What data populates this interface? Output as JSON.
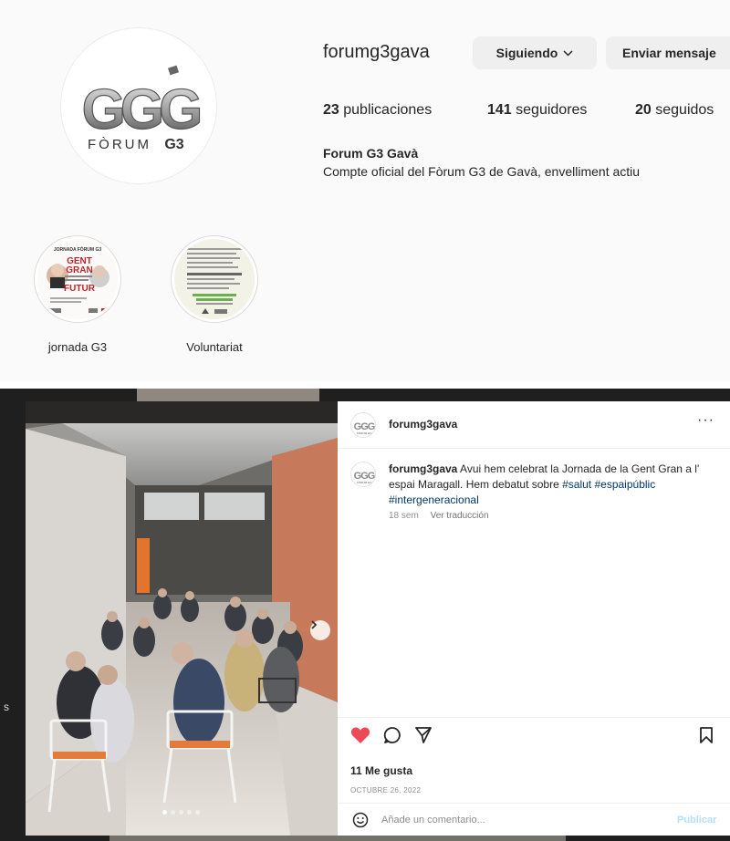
{
  "profile": {
    "username": "forumg3gava",
    "follow_button": "Siguiendo",
    "message_button": "Enviar mensaje",
    "stats": {
      "posts_count": "23",
      "posts_label": "publicaciones",
      "followers_count": "141",
      "followers_label": "seguidores",
      "following_count": "20",
      "following_label": "seguidos"
    },
    "display_name": "Forum G3 Gavà",
    "bio": "Compte oficial del Fòrum G3 de Gavà, envelliment actiu",
    "logo": {
      "letters": "GGG",
      "wordmark_left": "FÒRUM",
      "wordmark_right": "G3"
    }
  },
  "highlights": [
    {
      "label": "jornada G3",
      "cover_title": "JORNADA FÒRUM G3",
      "cover_headline_1": "GENT",
      "cover_headline_2": "GRAN",
      "cover_headline_3": "FUTUR"
    },
    {
      "label": "Voluntariat"
    }
  ],
  "post": {
    "header_user": "forumg3gava",
    "more_label": "···",
    "caption_user": "forumg3gava",
    "caption_text": "Avui hem celebrat la Jornada de la Gent Gran a l' espai Maragall. Hem debatut sobre ",
    "hashtags": [
      "#salut",
      "#espaipúblic",
      "#intergeneracional"
    ],
    "time_ago": "18 sem",
    "translate_label": "Ver traducción",
    "likes": "11 Me gusta",
    "date": "OCTUBRE 26, 2022",
    "comment_placeholder": "Añade un comentario...",
    "publish_label": "Publicar",
    "carousel": {
      "total_slides": 5,
      "active_slide": 1
    }
  },
  "colors": {
    "like_red": "#ed4956",
    "publish_blue": "#b2dffc",
    "hashtag_blue": "#00376b",
    "muted": "#8e8e8e"
  },
  "icons": [
    "heart-icon",
    "comment-icon",
    "share-icon",
    "bookmark-icon",
    "emoji-icon",
    "chevron-down-icon",
    "chevron-right-icon",
    "more-icon"
  ]
}
